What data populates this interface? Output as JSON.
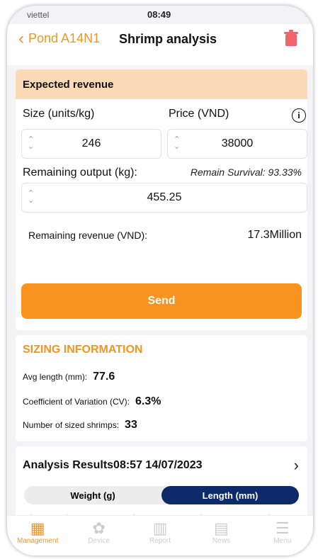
{
  "status": {
    "carrier": "viettel",
    "time": "08:49"
  },
  "nav": {
    "back_label": "Pond A14N1",
    "title": "Shrimp analysis"
  },
  "expected": {
    "header": "Expected revenue",
    "size_label": "Size (units/kg)",
    "price_label": "Price (VND)",
    "size_value": "246",
    "price_value": "38000",
    "remaining_output_label": "Remaining output (kg):",
    "remain_survival": "Remain Survival: 93.33%",
    "remaining_output_value": "455.25",
    "remaining_revenue_label": "Remaining revenue (VND):",
    "remaining_revenue_value": "17.3Million",
    "send_label": "Send"
  },
  "sizing": {
    "title": "SIZING INFORMATION",
    "avg_length_label": "Avg length (mm):",
    "avg_length_value": "77.6",
    "cv_label": "Coefficient of Variation (CV):",
    "cv_value": "6.3%",
    "count_label": "Number of sized shrimps:",
    "count_value": "33"
  },
  "results": {
    "title": "Analysis Results08:57 14/07/2023",
    "tabs": [
      "Weight (g)",
      "Length (mm)"
    ],
    "active_tab": "Length (mm)"
  },
  "tabbar": [
    {
      "label": "Management",
      "icon": "grid-icon",
      "active": true
    },
    {
      "label": "Device",
      "icon": "fan-icon",
      "active": false
    },
    {
      "label": "Report",
      "icon": "bar-chart-icon",
      "active": false
    },
    {
      "label": "News",
      "icon": "news-icon",
      "active": false
    },
    {
      "label": "Menu",
      "icon": "menu-icon",
      "active": false
    }
  ],
  "colors": {
    "accent": "#f39423",
    "header_bg": "#fad9b6",
    "toggle_active": "#0d2a6b",
    "trash": "#f0656b"
  }
}
